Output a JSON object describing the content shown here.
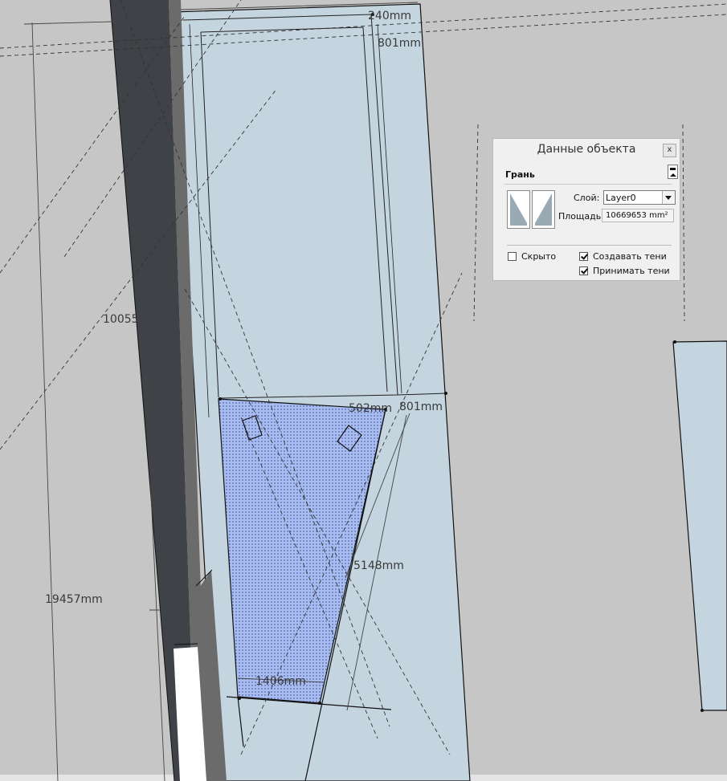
{
  "dimensions": [
    {
      "id": "dim-top",
      "label": "240mm"
    },
    {
      "id": "dim-top-right",
      "label": "801mm"
    },
    {
      "id": "dim-left",
      "label": "10055"
    },
    {
      "id": "dim-mid",
      "label": "502mm"
    },
    {
      "id": "dim-mid-right",
      "label": "801mm"
    },
    {
      "id": "dim-diagonal",
      "label": "5148mm"
    },
    {
      "id": "dim-bottom-left",
      "label": "19457mm"
    },
    {
      "id": "dim-bottom",
      "label": "1406mm"
    }
  ],
  "entity_info": {
    "title": "Данные объекта",
    "close_label": "x",
    "section_label": "Грань",
    "layer_label": "Слой:",
    "layer_value": "Layer0",
    "area_label": "Площадь:",
    "area_value": "10669653 mm²",
    "hidden_label": "Скрыто",
    "hidden_checked": false,
    "cast_shadows_label": "Создавать тени",
    "cast_shadows_checked": true,
    "receive_shadows_label": "Принимать тени",
    "receive_shadows_checked": true
  },
  "colors": {
    "background": "#c6c6c6",
    "face_fill": "#c5d5e0",
    "selected_face": "#a9bdf0",
    "wall_dark": "#3f4246",
    "wall_mid": "#6b6b6b"
  }
}
